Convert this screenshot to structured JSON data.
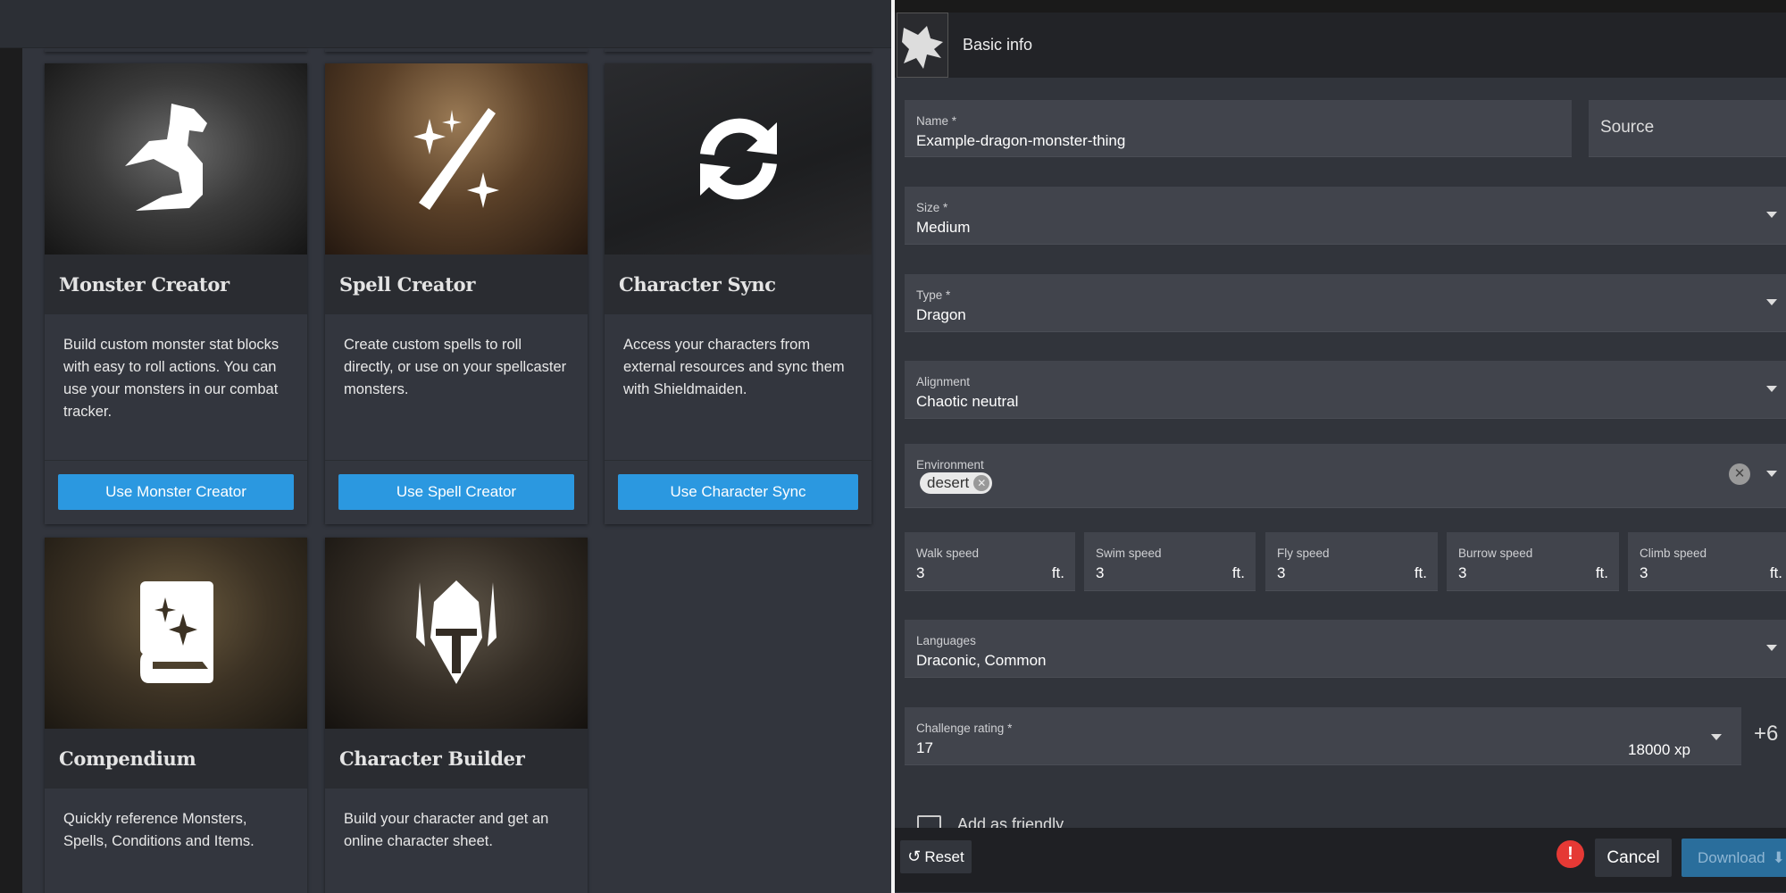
{
  "left_panel": {
    "cards": [
      {
        "title": "Monster Creator",
        "description": "Build custom monster stat blocks with easy to roll actions. You can use your monsters in our combat tracker.",
        "button": "Use Monster Creator",
        "icon": "dragon-icon"
      },
      {
        "title": "Spell Creator",
        "description": "Create custom spells to roll directly, or use on your spellcaster monsters.",
        "button": "Use Spell Creator",
        "icon": "magic-wand-icon"
      },
      {
        "title": "Character Sync",
        "description": "Access your characters from external resources and sync them with Shieldmaiden.",
        "button": "Use Character Sync",
        "icon": "sync-icon"
      },
      {
        "title": "Compendium",
        "description": "Quickly reference Monsters, Spells, Conditions and Items.",
        "icon": "spellbook-icon"
      },
      {
        "title": "Character Builder",
        "description": "Build your character and get an online character sheet.",
        "icon": "helmet-icon"
      }
    ],
    "button_color": "#2b98e0"
  },
  "right_panel": {
    "header": {
      "title": "Basic info"
    },
    "fields": {
      "name": {
        "label": "Name *",
        "value": "Example-dragon-monster-thing"
      },
      "source": {
        "placeholder": "Source"
      },
      "size": {
        "label": "Size *",
        "value": "Medium"
      },
      "type": {
        "label": "Type *",
        "value": "Dragon"
      },
      "alignment": {
        "label": "Alignment",
        "value": "Chaotic neutral"
      },
      "environment": {
        "label": "Environment",
        "chips": [
          "desert"
        ]
      },
      "speeds": [
        {
          "label": "Walk speed",
          "value": "3",
          "unit": "ft."
        },
        {
          "label": "Swim speed",
          "value": "3",
          "unit": "ft."
        },
        {
          "label": "Fly speed",
          "value": "3",
          "unit": "ft."
        },
        {
          "label": "Burrow speed",
          "value": "3",
          "unit": "ft."
        },
        {
          "label": "Climb speed",
          "value": "3",
          "unit": "ft."
        }
      ],
      "languages": {
        "label": "Languages",
        "value": "Draconic, Common"
      },
      "challenge_rating": {
        "label": "Challenge rating *",
        "value": "17",
        "xp": "18000 xp",
        "proficiency": "+6"
      },
      "friendly": {
        "label": "Add as friendly",
        "checked": false
      }
    },
    "footer": {
      "reset": "Reset",
      "cancel": "Cancel",
      "download": "Download",
      "alert": "!"
    },
    "alert_color": "#e53935",
    "download_color": "#2a6e9c"
  }
}
